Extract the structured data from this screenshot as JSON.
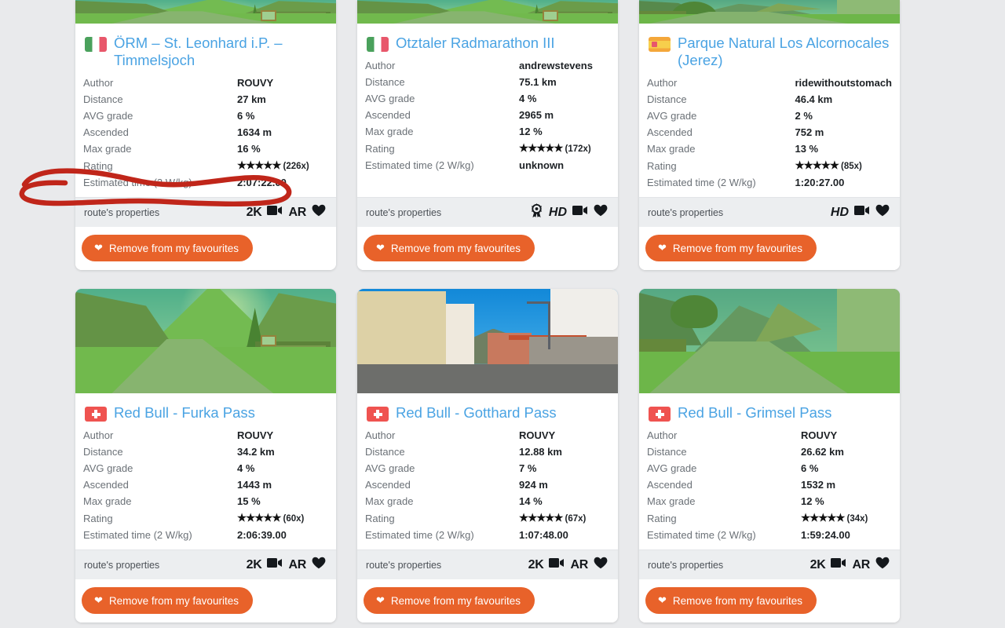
{
  "labels": {
    "author": "Author",
    "distance": "Distance",
    "avg_grade": "AVG grade",
    "ascended": "Ascended",
    "max_grade": "Max grade",
    "rating": "Rating",
    "estimated_time": "Estimated time (2 W/kg)",
    "route_properties": "route's properties",
    "remove_favourite": "Remove from my favourites",
    "stars": "★★★★★"
  },
  "colors": {
    "accent_orange": "#e8622a",
    "link_blue": "#4aa3e3",
    "annotation_red": "#c0261a",
    "page_background": "#e9eaec",
    "props_background": "#eceef0"
  },
  "cards": [
    {
      "id": "orm-st-leonhard",
      "flag": "flag-it",
      "flag_name": "flag-italy",
      "title": "ÖRM – St. Leonhard i.P. – Timmelsjoch",
      "image_clipped": true,
      "scene": "sceneA",
      "author": "ROUVY",
      "distance": "27 km",
      "avg_grade": "6 %",
      "ascended": "1634 m",
      "max_grade": "16 %",
      "rating_count": "(226x)",
      "estimated_time": "2:07:22.00",
      "annotated": true,
      "properties": [
        "2K",
        "video-camera",
        "AR",
        "heart"
      ]
    },
    {
      "id": "otztaler-radmarathon-iii",
      "flag": "flag-it",
      "flag_name": "flag-italy",
      "title": "Otztaler Radmarathon III",
      "image_clipped": true,
      "scene": "sceneA",
      "author": "andrewstevens",
      "distance": "75.1 km",
      "avg_grade": "4 %",
      "ascended": "2965 m",
      "max_grade": "12 %",
      "rating_count": "(172x)",
      "estimated_time": "unknown",
      "annotated": false,
      "properties": [
        "award",
        "HD",
        "video-camera",
        "heart"
      ]
    },
    {
      "id": "parque-natural-los-alcornocales",
      "flag": "flag-es",
      "flag_name": "flag-spain",
      "title": "Parque Natural Los Alcornocales (Jerez)",
      "image_clipped": true,
      "scene": "sceneC",
      "author": "ridewithoutstomach",
      "distance": "46.4 km",
      "avg_grade": "2 %",
      "ascended": "752 m",
      "max_grade": "13 %",
      "rating_count": "(85x)",
      "estimated_time": "1:20:27.00",
      "annotated": false,
      "properties": [
        "HD",
        "video-camera",
        "heart"
      ]
    },
    {
      "id": "red-bull-furka-pass",
      "flag": "flag-ch",
      "flag_name": "flag-switzerland",
      "title": "Red Bull - Furka Pass",
      "image_clipped": false,
      "scene": "sceneA",
      "author": "ROUVY",
      "distance": "34.2 km",
      "avg_grade": "4 %",
      "ascended": "1443 m",
      "max_grade": "15 %",
      "rating_count": "(60x)",
      "estimated_time": "2:06:39.00",
      "annotated": false,
      "properties": [
        "2K",
        "video-camera",
        "AR",
        "heart"
      ]
    },
    {
      "id": "red-bull-gotthard-pass",
      "flag": "flag-ch",
      "flag_name": "flag-switzerland",
      "title": "Red Bull - Gotthard Pass",
      "image_clipped": false,
      "scene": "sceneB",
      "author": "ROUVY",
      "distance": "12.88 km",
      "avg_grade": "7 %",
      "ascended": "924 m",
      "max_grade": "14 %",
      "rating_count": "(67x)",
      "estimated_time": "1:07:48.00",
      "annotated": false,
      "properties": [
        "2K",
        "video-camera",
        "AR",
        "heart"
      ]
    },
    {
      "id": "red-bull-grimsel-pass",
      "flag": "flag-ch",
      "flag_name": "flag-switzerland",
      "title": "Red Bull - Grimsel Pass",
      "image_clipped": false,
      "scene": "sceneC",
      "author": "ROUVY",
      "distance": "26.62 km",
      "avg_grade": "6 %",
      "ascended": "1532 m",
      "max_grade": "12 %",
      "rating_count": "(34x)",
      "estimated_time": "1:59:24.00",
      "annotated": false,
      "properties": [
        "2K",
        "video-camera",
        "AR",
        "heart"
      ]
    }
  ]
}
